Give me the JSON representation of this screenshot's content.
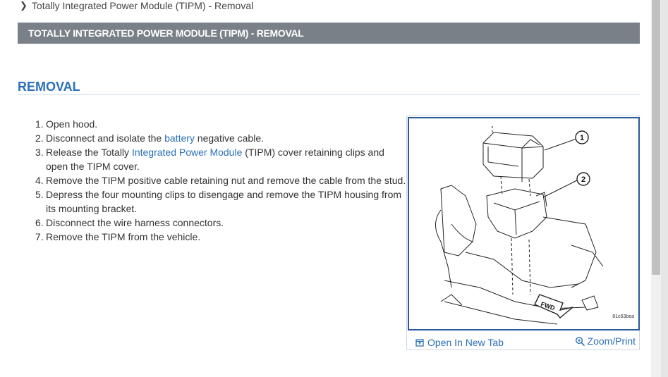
{
  "breadcrumb": {
    "text": "Totally Integrated Power Module (TIPM) - Removal"
  },
  "title_bar": {
    "text": "TOTALLY INTEGRATED POWER MODULE (TIPM) - REMOVAL"
  },
  "section": {
    "heading": "REMOVAL"
  },
  "steps": {
    "s1": {
      "num": "1.",
      "text": "Open hood."
    },
    "s2": {
      "num": "2.",
      "pre": "Disconnect and isolate the ",
      "link": "battery",
      "post": " negative cable."
    },
    "s3": {
      "num": "3.",
      "pre": "Release the Totally ",
      "link": "Integrated Power Module",
      "post": " (TIPM) cover retaining clips and open the TIPM cover."
    },
    "s4": {
      "num": "4.",
      "text": "Remove the TIPM positive cable retaining nut and remove the cable from the stud."
    },
    "s5": {
      "num": "5.",
      "text": "Depress the four mounting clips to disengage and remove the TIPM housing from its mounting bracket."
    },
    "s6": {
      "num": "6.",
      "text": "Disconnect the wire harness connectors."
    },
    "s7": {
      "num": "7.",
      "text": "Remove the TIPM from the vehicle."
    }
  },
  "figure": {
    "callout_1": "1",
    "callout_2": "2",
    "fwd_label": "FWD",
    "image_id": "81c63bea",
    "open_tab_label": "Open In New Tab",
    "zoom_label": "Zoom/Print"
  },
  "colors": {
    "title_bar": "#7a8088",
    "link": "#2a70b8",
    "figure_border": "#2a5a9a"
  }
}
